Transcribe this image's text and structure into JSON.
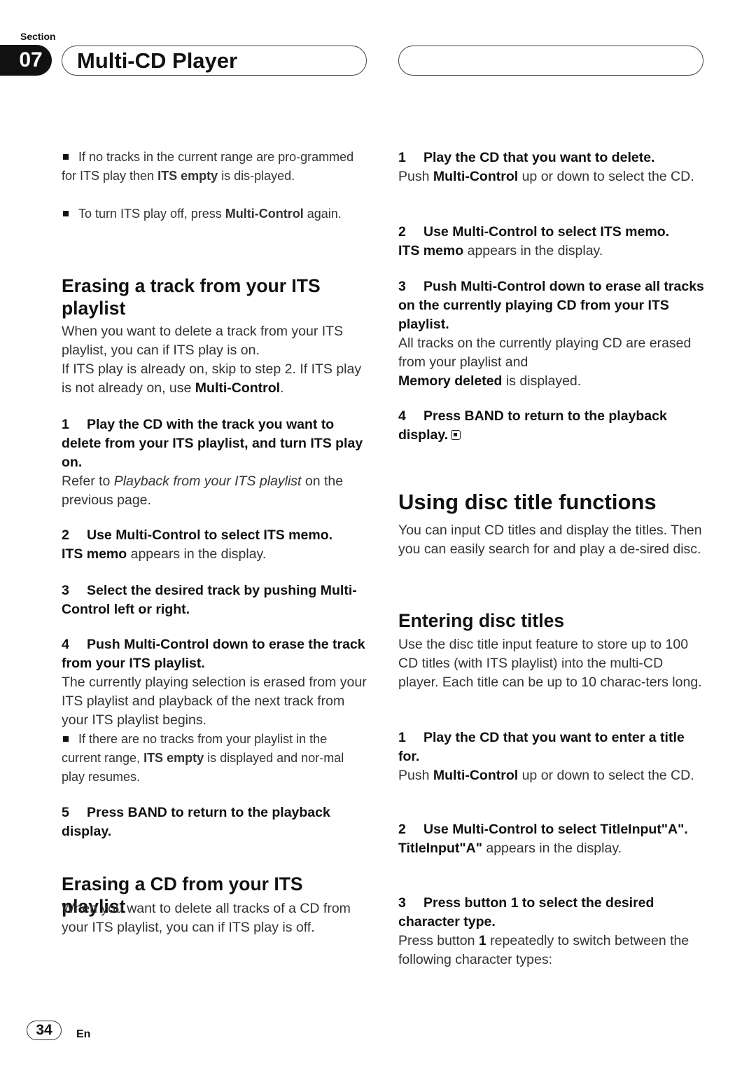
{
  "header": {
    "section_label": "Section",
    "section_number": "07",
    "chapter_title": "Multi-CD Player"
  },
  "left": {
    "notes_top": [
      {
        "pre": "If no tracks in the current range are pro-grammed for ITS play then ",
        "bold": "ITS empty",
        "post": " is dis-played."
      },
      {
        "pre": "To turn ITS play off, press ",
        "bold": "Multi-Control",
        "post": " again."
      }
    ],
    "erase_track": {
      "heading": "Erasing a track from your ITS playlist",
      "intro1": "When you want to delete a track from your ITS playlist, you can if ITS play is on.",
      "intro2_pre": "If ITS play is already on, skip to step 2. If ITS play is not already on, use ",
      "intro2_bold": "Multi-Control",
      "intro2_post": ".",
      "steps": [
        {
          "num": "1",
          "title": "Play the CD with the track you want to delete from your ITS playlist, and turn ITS play on.",
          "body_pre": "Refer to ",
          "body_italic": "Playback from your ITS playlist",
          "body_post": " on the previous page."
        },
        {
          "num": "2",
          "title": "Use Multi-Control to select ITS memo.",
          "body_bold": "ITS memo",
          "body_post": " appears in the display."
        },
        {
          "num": "3",
          "title": "Select the desired track by pushing Multi-Control left or right."
        },
        {
          "num": "4",
          "title": "Push Multi-Control down to erase the track from your ITS playlist.",
          "body": "The currently playing selection is erased from your ITS playlist and playback of the next track from your ITS playlist begins.",
          "note_pre": "If there are no tracks from your playlist in the current range, ",
          "note_bold": "ITS empty",
          "note_post": " is displayed and nor-mal play resumes."
        },
        {
          "num": "5",
          "title": "Press BAND to return to the playback display."
        }
      ]
    },
    "erase_cd": {
      "heading": "Erasing a CD from your ITS playlist",
      "intro": "When you want to delete all tracks of a CD from your ITS playlist, you can if ITS play is off."
    }
  },
  "right": {
    "erase_cd_steps": [
      {
        "num": "1",
        "title": "Play the CD that you want to delete.",
        "body_pre": "Push ",
        "body_bold": "Multi-Control",
        "body_post": " up or down to select the CD."
      },
      {
        "num": "2",
        "title": "Use Multi-Control to select ITS memo.",
        "body_bold": "ITS memo",
        "body_post": " appears in the display."
      },
      {
        "num": "3",
        "title": "Push Multi-Control down to erase all tracks on the currently playing CD from your ITS playlist.",
        "body": "All tracks on the currently playing CD are erased from your playlist and",
        "body2_bold": "Memory deleted",
        "body2_post": " is displayed."
      },
      {
        "num": "4",
        "title": "Press BAND to return to the playback display.",
        "end_icon": "end-of-section-icon"
      }
    ],
    "disc_title": {
      "heading": "Using disc title functions",
      "intro": "You can input CD titles and display the titles. Then you can easily search for and play a de-sired disc."
    },
    "entering": {
      "heading": "Entering disc titles",
      "intro": "Use the disc title input feature to store up to 100 CD titles  (with ITS playlist) into the multi-CD player. Each title can be up to 10 charac-ters long.",
      "steps": [
        {
          "num": "1",
          "title": "Play the CD that you want to enter a title for.",
          "body_pre": "Push ",
          "body_bold": "Multi-Control",
          "body_post": " up or down to select the CD."
        },
        {
          "num": "2",
          "title": "Use Multi-Control to select TitleInput\"A\".",
          "body_bold": "TitleInput\"A\"",
          "body_post": " appears in the display."
        },
        {
          "num": "3",
          "title": "Press button 1 to select the desired character type.",
          "body_pre": "Press button ",
          "body_bold": "1",
          "body_post": " repeatedly to switch between the following character types:"
        }
      ]
    }
  },
  "footer": {
    "page_number": "34",
    "language": "En"
  }
}
